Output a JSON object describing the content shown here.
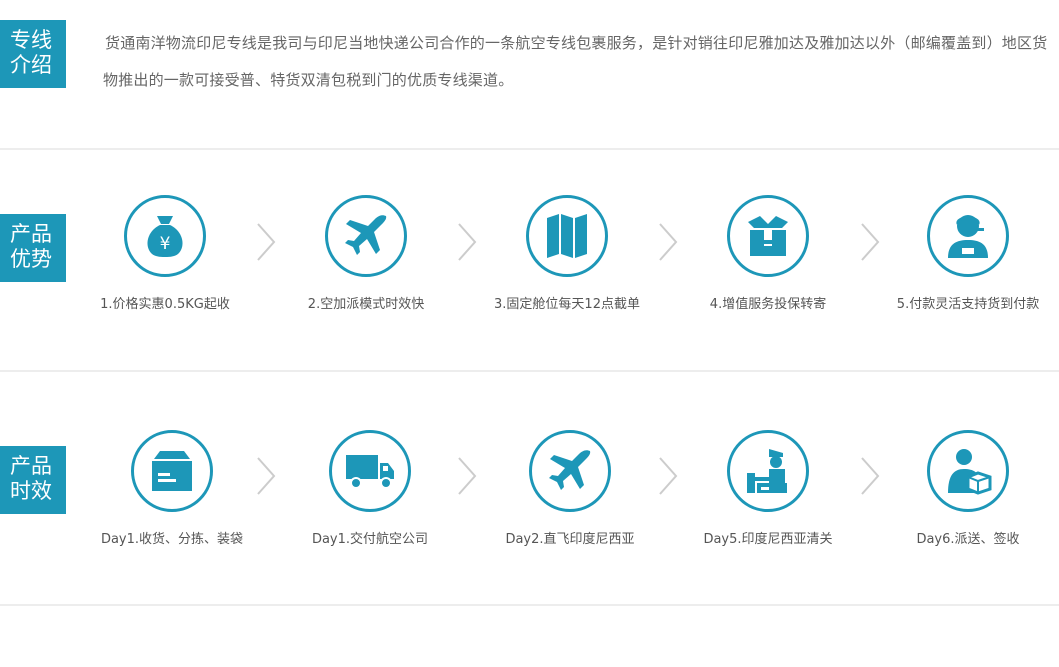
{
  "colors": {
    "accent": "#1d97b8",
    "divider": "#ededed"
  },
  "intro": {
    "tag": [
      "专线",
      "介绍"
    ],
    "text": "货通南洋物流印尼专线是我司与印尼当地快递公司合作的一条航空专线包裹服务，是针对销往印尼雅加达及雅加达以外（邮编覆盖到）地区货物推出的一款可接受普、特货双清包税到门的优质专线渠道。"
  },
  "advantages": {
    "tag": [
      "产品",
      "优势"
    ],
    "items": [
      {
        "icon": "money-bag-icon",
        "label": "1.价格实惠0.5KG起收"
      },
      {
        "icon": "airplane-icon",
        "label": "2.空加派模式时效快"
      },
      {
        "icon": "map-icon",
        "label": "3.固定舱位每天12点截单"
      },
      {
        "icon": "package-box-icon",
        "label": "4.增值服务投保转寄"
      },
      {
        "icon": "support-agent-icon",
        "label": "5.付款灵活支持货到付款"
      }
    ]
  },
  "timeline": {
    "tag": [
      "产品",
      "时效"
    ],
    "items": [
      {
        "icon": "parcel-icon",
        "label": "Day1.收货、分拣、装袋"
      },
      {
        "icon": "truck-icon",
        "label": "Day1.交付航空公司"
      },
      {
        "icon": "airplane-icon",
        "label": "Day2.直飞印度尼西亚"
      },
      {
        "icon": "customs-officer-icon",
        "label": "Day5.印度尼西亚清关"
      },
      {
        "icon": "delivery-person-icon",
        "label": "Day6.派送、签收"
      }
    ]
  }
}
